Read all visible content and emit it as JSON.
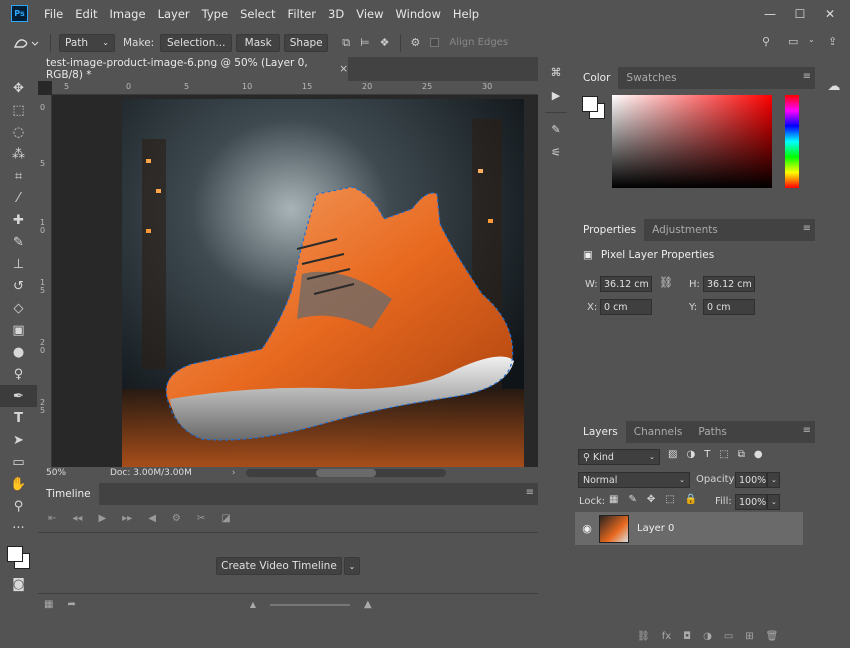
{
  "app": {
    "logo": "Ps"
  },
  "menu": {
    "items": [
      "File",
      "Edit",
      "Image",
      "Layer",
      "Type",
      "Select",
      "Filter",
      "3D",
      "View",
      "Window",
      "Help"
    ]
  },
  "window_controls": {
    "minimize": "—",
    "maximize": "☐",
    "close": "✕"
  },
  "options_bar": {
    "path_select": "Path",
    "make_label": "Make:",
    "selection_button": "Selection...",
    "mask_button": "Mask",
    "shape_button": "Shape",
    "align_edges_label": "Align Edges"
  },
  "document": {
    "tab_title": "test-image-product-image-6.png @ 50% (Layer 0, RGB/8) *",
    "tab_close": "×",
    "ruler_h_ticks": [
      "5",
      "0",
      "5",
      "10",
      "15",
      "20",
      "25",
      "30"
    ],
    "ruler_v_ticks": [
      "0",
      "5",
      "1 0",
      "1 5",
      "2 0",
      "2 5"
    ],
    "zoom": "50%",
    "doc_info": "Doc: 3.00M/3.00M"
  },
  "timeline": {
    "tab_label": "Timeline",
    "create_button": "Create Video Timeline"
  },
  "color_panel": {
    "tabs": [
      "Color",
      "Swatches"
    ],
    "foreground": "#ffffff",
    "hue_color": "#ff0000"
  },
  "properties_panel": {
    "tabs": [
      "Properties",
      "Adjustments"
    ],
    "title": "Pixel Layer Properties",
    "w_label": "W:",
    "w_value": "36.12 cm",
    "h_label": "H:",
    "h_value": "36.12 cm",
    "x_label": "X:",
    "x_value": "0 cm",
    "y_label": "Y:",
    "y_value": "0 cm"
  },
  "layers_panel": {
    "tabs": [
      "Layers",
      "Channels",
      "Paths"
    ],
    "filter_kind": "Kind",
    "blend_mode": "Normal",
    "opacity_label": "Opacity:",
    "opacity_value": "100%",
    "lock_label": "Lock:",
    "fill_label": "Fill:",
    "fill_value": "100%",
    "layers": [
      {
        "name": "Layer 0"
      }
    ]
  },
  "colors": {
    "ui_bg": "#535353",
    "panel_dark": "#424242",
    "selected_layer": "#6a6a6a",
    "accent_blue": "#31a8ff"
  }
}
